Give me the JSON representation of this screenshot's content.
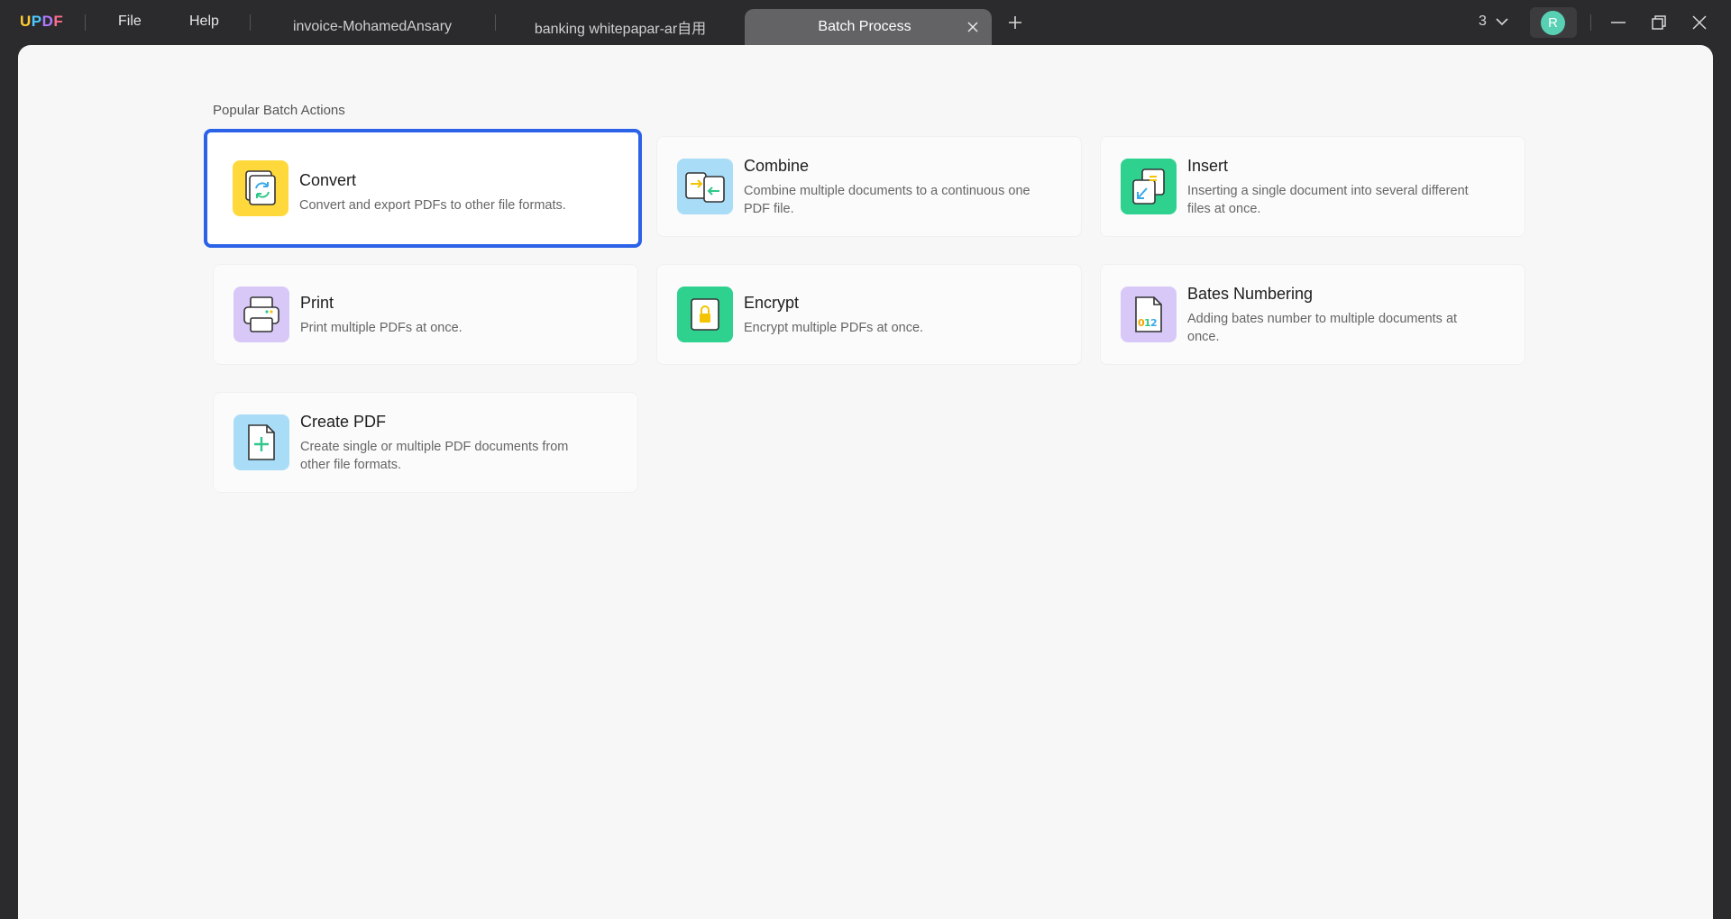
{
  "app": {
    "logo": {
      "u": "U",
      "p": "P",
      "d": "D",
      "f": "F"
    }
  },
  "menu": {
    "file": "File",
    "help": "Help"
  },
  "tabs": [
    {
      "label": "invoice-MohamedAnsary"
    },
    {
      "label": "banking whitepapar-ar自用"
    },
    {
      "label": "Batch Process",
      "active": true
    }
  ],
  "titlebar": {
    "count": "3",
    "avatar_initial": "R"
  },
  "main": {
    "section_title": "Popular Batch Actions",
    "actions": [
      {
        "title": "Convert",
        "desc": "Convert and export PDFs to other file formats.",
        "icon": "convert-icon",
        "color": "#ffd93b",
        "selected": true
      },
      {
        "title": "Combine",
        "desc": "Combine multiple documents to a continuous one PDF file.",
        "icon": "combine-icon",
        "color": "#a9ddf7"
      },
      {
        "title": "Insert",
        "desc": "Inserting a single document into several different files at once.",
        "icon": "insert-icon",
        "color": "#2fd18f"
      },
      {
        "title": "Print",
        "desc": "Print multiple PDFs at once.",
        "icon": "printer-icon",
        "color": "#d8c8f8"
      },
      {
        "title": "Encrypt",
        "desc": "Encrypt multiple PDFs at once.",
        "icon": "lock-icon",
        "color": "#2fd18f"
      },
      {
        "title": "Bates Numbering",
        "desc": "Adding bates number to multiple documents at once.",
        "icon": "bates-numbering-icon",
        "color": "#d8c8f8"
      },
      {
        "title": "Create PDF",
        "desc": "Create single or multiple PDF documents from other file formats.",
        "icon": "create-pdf-icon",
        "color": "#a9ddf7"
      }
    ]
  }
}
